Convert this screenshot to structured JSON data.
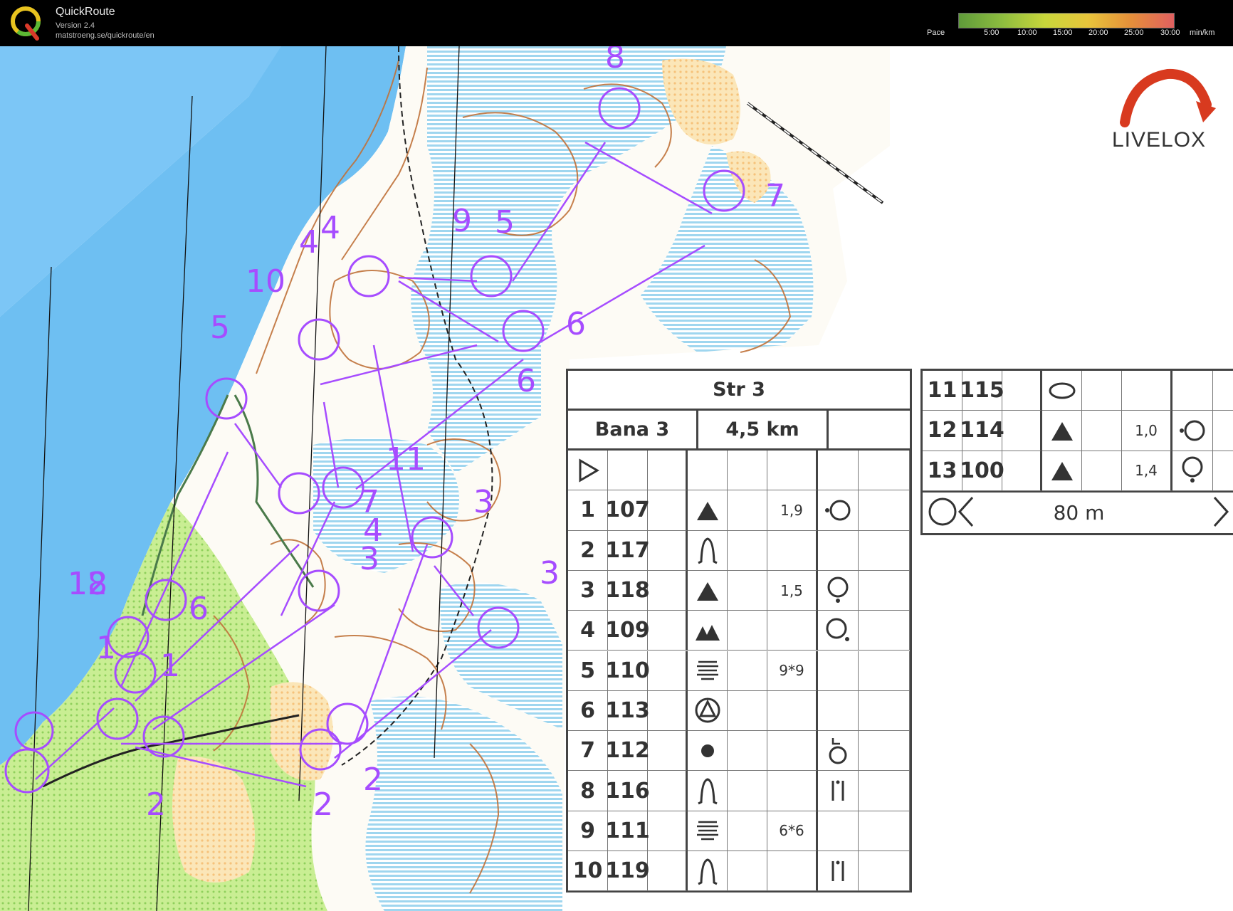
{
  "app": {
    "title": "QuickRoute",
    "version": "Version 2.4",
    "url": "matstroeng.se/quickroute/en",
    "logo_icon": "quickroute-q-logo-icon"
  },
  "pace_legend": {
    "label": "Pace",
    "ticks": [
      "5:00",
      "10:00",
      "15:00",
      "20:00",
      "25:00",
      "30:00"
    ],
    "unit": "min/km",
    "colors": [
      "#5f9b3a",
      "#c8d63b",
      "#e8c53b",
      "#e58f3a",
      "#e06060"
    ]
  },
  "brand": {
    "name": "LIVELOX",
    "icon": "livelox-arrow-icon"
  },
  "map": {
    "course_color": "#a64cff",
    "water_color": "#6ec5f5",
    "control_labels": [
      "8",
      "7",
      "5",
      "9",
      "4",
      "10",
      "5",
      "6",
      "6",
      "11",
      "3",
      "7",
      "4",
      "3",
      "3",
      "18",
      "6",
      "1",
      "2",
      "2",
      "2",
      "4",
      "1",
      "12"
    ]
  },
  "control_description": {
    "event": "Str 3",
    "course": "Bana 3",
    "length": "4,5 km",
    "start_icon": "start-triangle-icon",
    "controls": [
      {
        "no": "1",
        "code": "107",
        "feature_icon": "knoll-icon",
        "dimension": "1,9",
        "location_icon": "west-side-circle-icon"
      },
      {
        "no": "2",
        "code": "117",
        "feature_icon": "spur-icon",
        "dimension": "",
        "location_icon": ""
      },
      {
        "no": "3",
        "code": "118",
        "feature_icon": "knoll-icon",
        "dimension": "1,5",
        "location_icon": "foot-circle-icon"
      },
      {
        "no": "4",
        "code": "109",
        "feature_icon": "double-knoll-icon",
        "dimension": "",
        "location_icon": "southeast-circle-icon"
      },
      {
        "no": "5",
        "code": "110",
        "feature_icon": "marsh-icon",
        "dimension": "9*9",
        "location_icon": ""
      },
      {
        "no": "6",
        "code": "113",
        "feature_icon": "boulder-in-circle-icon",
        "dimension": "",
        "location_icon": ""
      },
      {
        "no": "7",
        "code": "112",
        "feature_icon": "pit-icon",
        "dimension": "",
        "location_icon": "top-corner-circle-icon"
      },
      {
        "no": "8",
        "code": "116",
        "feature_icon": "spur-icon",
        "dimension": "",
        "location_icon": "between-icon"
      },
      {
        "no": "9",
        "code": "111",
        "feature_icon": "marsh-icon",
        "dimension": "6*6",
        "location_icon": ""
      },
      {
        "no": "10",
        "code": "119",
        "feature_icon": "spur-icon",
        "dimension": "",
        "location_icon": "between-icon"
      },
      {
        "no": "11",
        "code": "115",
        "feature_icon": "ellipse-icon",
        "dimension": "",
        "location_icon": ""
      },
      {
        "no": "12",
        "code": "114",
        "feature_icon": "knoll-icon",
        "dimension": "1,0",
        "location_icon": "west-side-circle-icon"
      },
      {
        "no": "13",
        "code": "100",
        "feature_icon": "knoll-icon",
        "dimension": "1,4",
        "location_icon": "foot-circle-icon"
      }
    ],
    "finish_distance": "80 m",
    "finish_icon": "finish-funnel-icon"
  }
}
